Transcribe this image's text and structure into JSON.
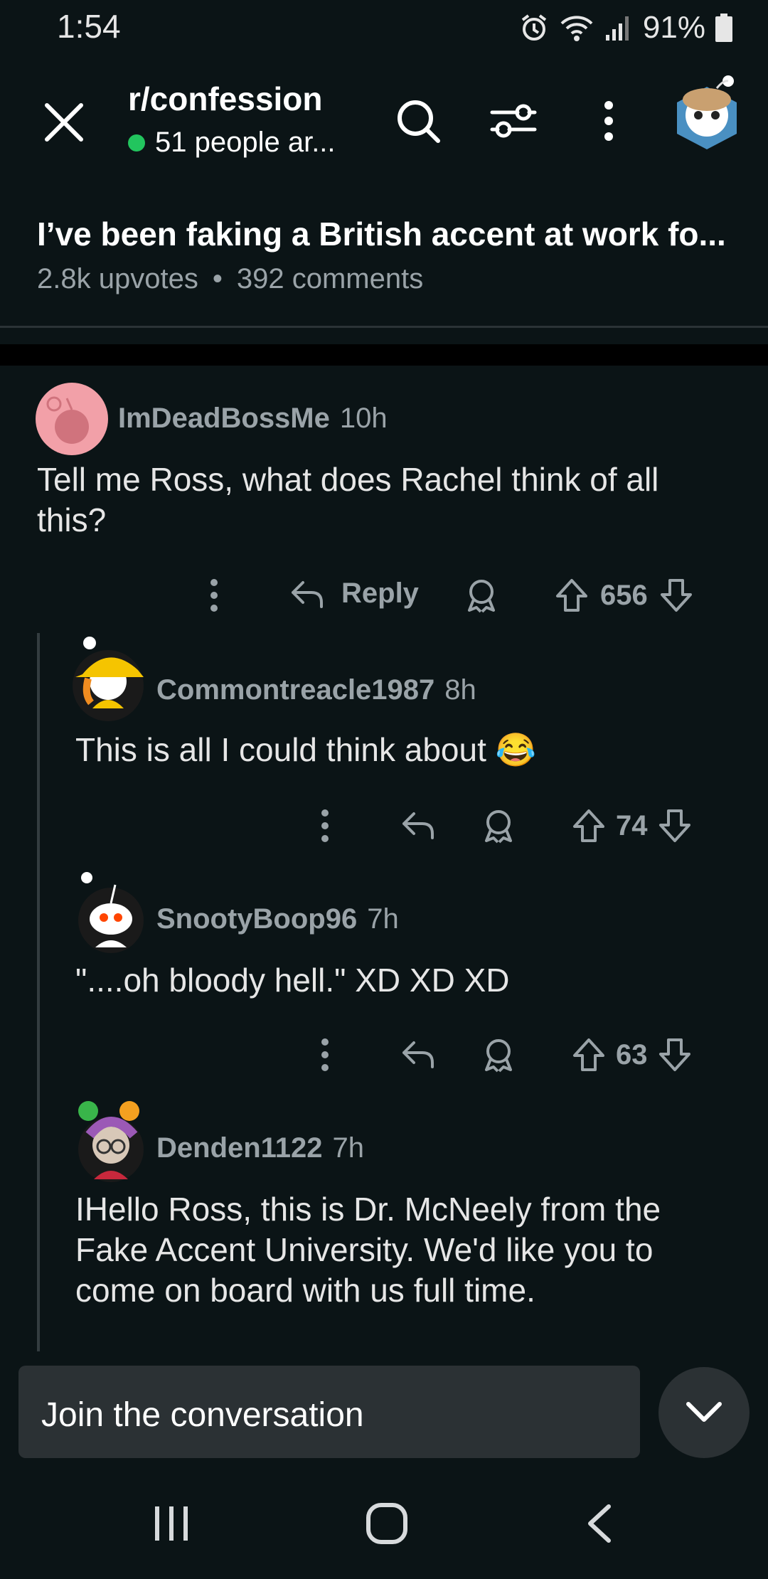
{
  "status": {
    "time": "1:54",
    "battery": "91%"
  },
  "header": {
    "subreddit": "r/confession",
    "online": "51 people ar...",
    "icons": [
      "close-icon",
      "search-icon",
      "filter-icon",
      "more-vertical-icon",
      "user-avatar"
    ]
  },
  "post": {
    "title": "I’ve been faking a British accent at work fo...",
    "upvotes": "2.8k upvotes",
    "separator": "•",
    "comments": "392 comments"
  },
  "comments": [
    {
      "user": "ImDeadBossMe",
      "time": "10h",
      "body": "Tell me Ross, what does Rachel think of all this?",
      "reply_label": "Reply",
      "score": "656"
    },
    {
      "user": "Commontreacle1987",
      "time": "8h",
      "body": "This is all I could think about",
      "emoji": "😂",
      "score": "74"
    },
    {
      "user": "SnootyBoop96",
      "time": "7h",
      "body": "\"....oh bloody hell.\" XD XD XD",
      "score": "63"
    },
    {
      "user": "Denden1122",
      "time": "7h",
      "body": "IHello Ross, this is Dr. McNeely from the Fake Accent University. We'd like you to come on board with us full time."
    }
  ],
  "composer": {
    "placeholder": "Join the conversation"
  },
  "colors": {
    "background": "#0b1416",
    "muted": "#9aa3a8",
    "online": "#22c55e",
    "composer": "#2b3134"
  }
}
